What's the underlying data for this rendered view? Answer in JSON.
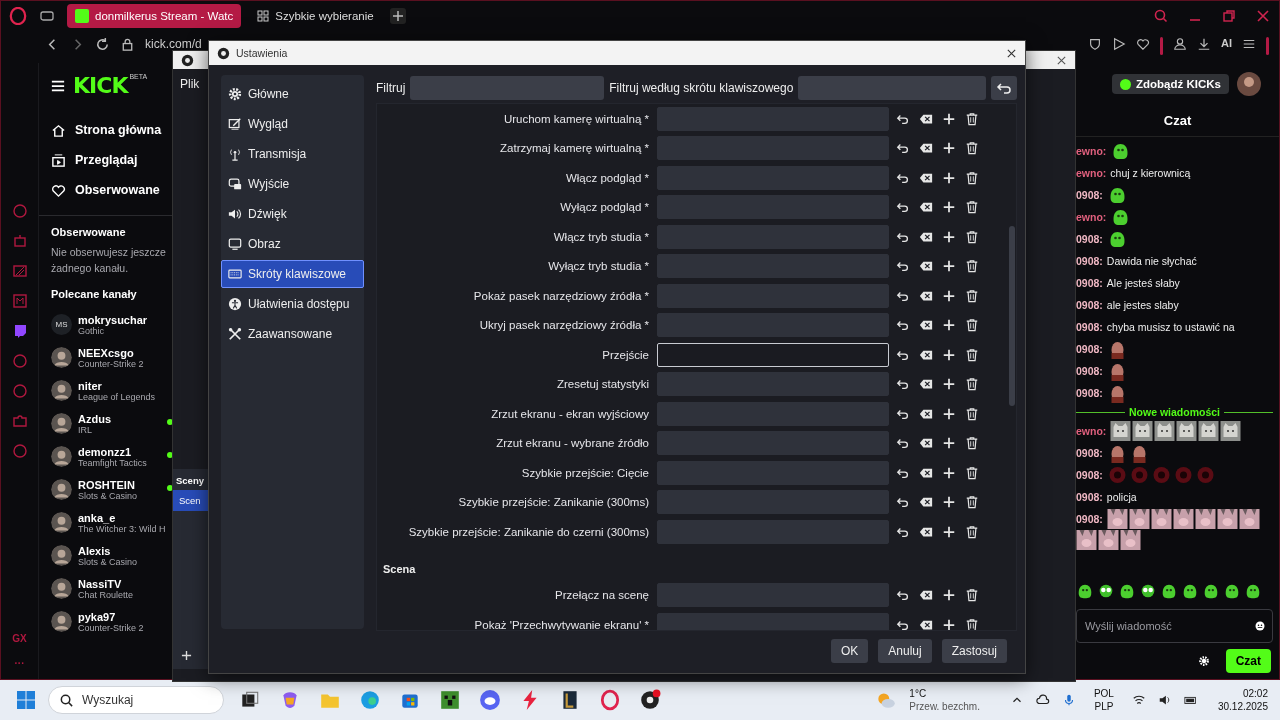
{
  "browser": {
    "tabs": [
      {
        "title": "donmilkerus Stream - Watc",
        "selected": true
      },
      {
        "title": "Szybkie wybieranie",
        "selected": false
      }
    ],
    "address": "kick.com/d",
    "toolbar_ai": "AI"
  },
  "opera_sidebar": {
    "gx": "GX",
    "more": "···"
  },
  "kick_nav": {
    "logo": "KICK",
    "logo_badge": "BETA",
    "items": [
      {
        "label": "Strona główna",
        "kind": "home"
      },
      {
        "label": "Przeglądaj",
        "kind": "browse"
      },
      {
        "label": "Obserwowane",
        "kind": "heart"
      }
    ],
    "followed_title": "Obserwowane",
    "followed_empty": "Nie obserwujesz jeszcze żadnego kanału.",
    "recommended_title": "Polecane kanały",
    "channels": [
      {
        "name": "mokrysuchar",
        "game": "Gothic",
        "initials": "MS",
        "live": false
      },
      {
        "name": "NEEXcsgo",
        "game": "Counter-Strike 2",
        "live": false
      },
      {
        "name": "niter",
        "game": "League of Legends",
        "live": false
      },
      {
        "name": "Azdus",
        "game": "IRL",
        "live": true
      },
      {
        "name": "demonzz1",
        "game": "Teamfight Tactics",
        "live": true
      },
      {
        "name": "ROSHTEIN",
        "game": "Slots & Casino",
        "live": true
      },
      {
        "name": "anka_e",
        "game": "The Witcher 3: Wild H",
        "live": false
      },
      {
        "name": "Alexis",
        "game": "Slots & Casino",
        "live": false
      },
      {
        "name": "NassiTV",
        "game": "Chat Roulette",
        "live": false
      },
      {
        "name": "pyka97",
        "game": "Counter-Strike 2",
        "live": false
      }
    ]
  },
  "obs_main": {
    "menu": "Plik",
    "scenes_title": "Sceny",
    "scene": "Scen"
  },
  "settings": {
    "title": "Ustawienia",
    "nav": [
      {
        "label": "Główne",
        "kind": "gear",
        "selected": false
      },
      {
        "label": "Wygląd",
        "kind": "appearance",
        "selected": false
      },
      {
        "label": "Transmisja",
        "kind": "antenna",
        "selected": false
      },
      {
        "label": "Wyjście",
        "kind": "output",
        "selected": false
      },
      {
        "label": "Dźwięk",
        "kind": "speaker",
        "selected": false
      },
      {
        "label": "Obraz",
        "kind": "monitor",
        "selected": false
      },
      {
        "label": "Skróty klawiszowe",
        "kind": "keyboard",
        "selected": true
      },
      {
        "label": "Ułatwienia dostępu",
        "kind": "accessibility",
        "selected": false
      },
      {
        "label": "Zaawansowane",
        "kind": "tools",
        "selected": false
      }
    ],
    "filter_label": "Filtruj",
    "filter_key_label": "Filtruj według skrótu klawiszowego",
    "hotkeys": [
      {
        "label": "Uruchom kamerę wirtualną *",
        "focused": false
      },
      {
        "label": "Zatrzymaj kamerę wirtualną *",
        "focused": false
      },
      {
        "label": "Włącz podgląd *",
        "focused": false
      },
      {
        "label": "Wyłącz podgląd *",
        "focused": false
      },
      {
        "label": "Włącz tryb studia *",
        "focused": false
      },
      {
        "label": "Wyłącz tryb studia *",
        "focused": false
      },
      {
        "label": "Pokaż pasek narzędziowy źródła *",
        "focused": false
      },
      {
        "label": "Ukryj pasek narzędziowy źródła *",
        "focused": false
      },
      {
        "label": "Przejście",
        "focused": true
      },
      {
        "label": "Zresetuj statystyki",
        "focused": false
      },
      {
        "label": "Zrzut ekranu - ekran wyjściowy",
        "focused": false
      },
      {
        "label": "Zrzut ekranu - wybrane źródło",
        "focused": false
      },
      {
        "label": "Szybkie przejście: Cięcie",
        "focused": false
      },
      {
        "label": "Szybkie przejście: Zanikanie (300ms)",
        "focused": false
      },
      {
        "label": "Szybkie przejście: Zanikanie do czerni (300ms)",
        "focused": false
      }
    ],
    "section": "Scena",
    "section_hotkeys": [
      {
        "label": "Przełącz na scenę",
        "focused": false
      },
      {
        "label": "Pokaż 'Przechwytywanie ekranu' *",
        "focused": false
      }
    ],
    "buttons": [
      "OK",
      "Anuluj",
      "Zastosuj"
    ]
  },
  "chat": {
    "earn_button": "Zdobądź KICKs",
    "title": "Czat",
    "messages": [
      {
        "user": "ewno:",
        "color": "#e0607e",
        "emotes": [
          {
            "kind": "blob"
          }
        ]
      },
      {
        "user": "ewno:",
        "color": "#e0607e",
        "text": "chuj z kierownicą"
      },
      {
        "user": "0908:",
        "color": "#f0b8c4",
        "emotes": [
          {
            "kind": "blob"
          }
        ]
      },
      {
        "user": "ewno:",
        "color": "#e0607e",
        "emotes": [
          {
            "kind": "blob"
          }
        ]
      },
      {
        "user": "0908:",
        "color": "#f0b8c4",
        "emotes": [
          {
            "kind": "blob"
          }
        ]
      },
      {
        "user": "0908:",
        "color": "#f0b8c4",
        "text": "Dawida nie słychać"
      },
      {
        "user": "0908:",
        "color": "#f0b8c4",
        "text": "Ale jesteś słaby"
      },
      {
        "user": "0908:",
        "color": "#f0b8c4",
        "text": "ale jestes slaby"
      },
      {
        "user": "0908:",
        "color": "#f0b8c4",
        "text": "chyba musisz to ustawić na"
      },
      {
        "user": "0908:",
        "color": "#f0b8c4",
        "emotes": [
          {
            "kind": "face"
          }
        ]
      },
      {
        "user": "0908:",
        "color": "#f0b8c4",
        "emotes": [
          {
            "kind": "face"
          }
        ]
      },
      {
        "user": "0908:",
        "color": "#f0b8c4",
        "emotes": [
          {
            "kind": "face"
          }
        ]
      },
      {
        "kind": "divider",
        "text": "Nowe wiadomości"
      },
      {
        "user": "ewno:",
        "color": "#e0607e",
        "emotes": [
          {
            "kind": "cat"
          },
          {
            "kind": "cat"
          },
          {
            "kind": "cat"
          },
          {
            "kind": "cat"
          },
          {
            "kind": "cat"
          },
          {
            "kind": "cat"
          }
        ]
      },
      {
        "user": "0908:",
        "color": "#f0b8c4",
        "emotes": [
          {
            "kind": "face"
          },
          {
            "kind": "face"
          }
        ]
      },
      {
        "user": "0908:",
        "color": "#f0b8c4",
        "emotes": [
          {
            "kind": "red"
          },
          {
            "kind": "red"
          },
          {
            "kind": "red"
          },
          {
            "kind": "red"
          },
          {
            "kind": "red"
          }
        ]
      },
      {
        "user": "0908:",
        "color": "#f0b8c4",
        "text": "policja"
      },
      {
        "user": "0908:",
        "color": "#f0b8c4",
        "emotes": [
          {
            "kind": "pinkcat"
          },
          {
            "kind": "pinkcat"
          },
          {
            "kind": "pinkcat"
          },
          {
            "kind": "pinkcat"
          },
          {
            "kind": "pinkcat"
          },
          {
            "kind": "pinkcat"
          },
          {
            "kind": "pinkcat"
          },
          {
            "kind": "pinkcat"
          },
          {
            "kind": "pinkcat"
          },
          {
            "kind": "pinkcat"
          }
        ]
      }
    ],
    "emote_bar": [
      {
        "kind": "blob"
      },
      {
        "kind": "alien"
      },
      {
        "kind": "blob"
      },
      {
        "kind": "alien"
      },
      {
        "kind": "blob"
      },
      {
        "kind": "blob"
      },
      {
        "kind": "blob"
      },
      {
        "kind": "blob"
      },
      {
        "kind": "blob"
      }
    ],
    "input_placeholder": "Wyślij wiadomość",
    "send_button": "Czat"
  },
  "taskbar": {
    "search_placeholder": "Wyszukaj",
    "temperature": "1°C",
    "weather": "Przew. bezchm.",
    "lang": "POL",
    "layout": "PLP",
    "time": "02:02",
    "date": "30.12.2025"
  }
}
